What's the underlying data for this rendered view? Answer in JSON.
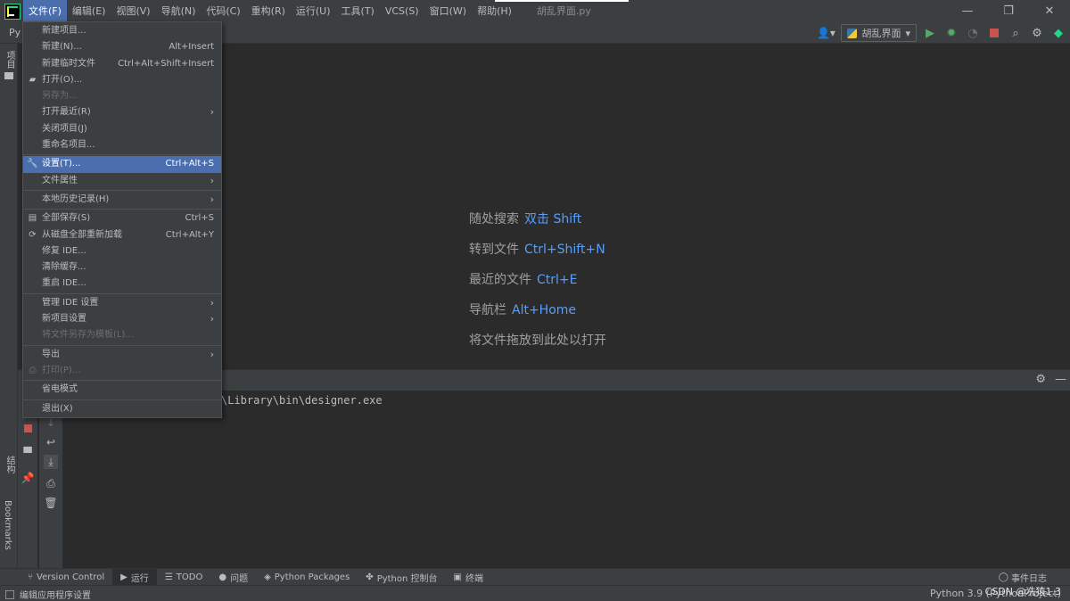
{
  "menubar": {
    "items": [
      "文件(F)",
      "编辑(E)",
      "视图(V)",
      "导航(N)",
      "代码(C)",
      "重构(R)",
      "运行(U)",
      "工具(T)",
      "VCS(S)",
      "窗口(W)",
      "帮助(H)"
    ],
    "window_title": "胡乱界面.py"
  },
  "toolbar": {
    "project_crumb": "Py",
    "run_config": "胡乱界面"
  },
  "left_strip": {
    "project_label": "项目",
    "structure_label": "结构",
    "bookmarks_label": "Bookmarks"
  },
  "file_menu": {
    "new_project": "新建项目...",
    "new": "新建(N)...",
    "new_shortcut": "Alt+Insert",
    "new_scratch": "新建临时文件",
    "new_scratch_shortcut": "Ctrl+Alt+Shift+Insert",
    "open": "打开(O)...",
    "save_as": "另存为...",
    "open_recent": "打开最近(R)",
    "close_project": "关闭项目(J)",
    "rename_project": "重命名项目...",
    "settings": "设置(T)...",
    "settings_shortcut": "Ctrl+Alt+S",
    "file_properties": "文件属性",
    "local_history": "本地历史记录(H)",
    "save_all": "全部保存(S)",
    "save_all_shortcut": "Ctrl+S",
    "reload_all": "从磁盘全部重新加载",
    "reload_all_shortcut": "Ctrl+Alt+Y",
    "repair_ide": "修复 IDE...",
    "invalidate_caches": "清除缓存...",
    "restart_ide": "重启 IDE...",
    "manage_ide_settings": "管理 IDE 设置",
    "new_project_settings": "新项目设置",
    "save_as_template": "将文件另存为模板(L)...",
    "export": "导出",
    "print": "打印(P)...",
    "power_save": "省电模式",
    "exit": "退出(X)"
  },
  "welcome": {
    "search_label": "随处搜索",
    "search_key": "双击 Shift",
    "goto_file_label": "转到文件",
    "goto_file_key": "Ctrl+Shift+N",
    "recent_label": "最近的文件",
    "recent_key": "Ctrl+E",
    "navbar_label": "导航栏",
    "navbar_key": "Alt+Home",
    "drop_hint": "将文件拖放到此处以打开"
  },
  "console": {
    "line": "\\Library\\bin\\designer.exe"
  },
  "bottom_tabs": {
    "version_control": "Version Control",
    "run": "运行",
    "todo": "TODO",
    "problems": "问题",
    "python_packages": "Python Packages",
    "python_console": "Python 控制台",
    "terminal": "终端",
    "event_log": "事件日志"
  },
  "statusbar": {
    "message": "编辑应用程序设置",
    "interpreter": "Python 3.9 (PythonProject)",
    "watermark": "CSDN @冼猿1.3"
  },
  "colors": {
    "background": "#2b2b2b",
    "panel": "#3c3f41",
    "selection": "#4b6eaf",
    "key_hint": "#589df6"
  }
}
